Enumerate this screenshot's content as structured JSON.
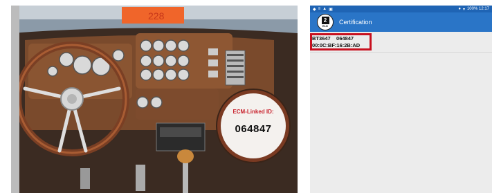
{
  "photo": {
    "ecm_badge": {
      "label": "ECM-Linked ID:",
      "value": "064847"
    },
    "plate_text": "228"
  },
  "phone": {
    "statusbar": {
      "left_icons": [
        "notification-icon",
        "menu-icon",
        "warning-icon",
        "image-icon"
      ],
      "right_text": "100% 12:17"
    },
    "appbar": {
      "title": "Certification",
      "logo_text": "2",
      "logo_sub": "ELD"
    },
    "certifications": [
      {
        "line1": "BT3647    064847",
        "line2": "00:0C:BF:16:2B:AD"
      }
    ],
    "colors": {
      "appbar": "#2a75c7",
      "statusbar": "#1f64b4",
      "highlight": "#c8101f"
    }
  }
}
